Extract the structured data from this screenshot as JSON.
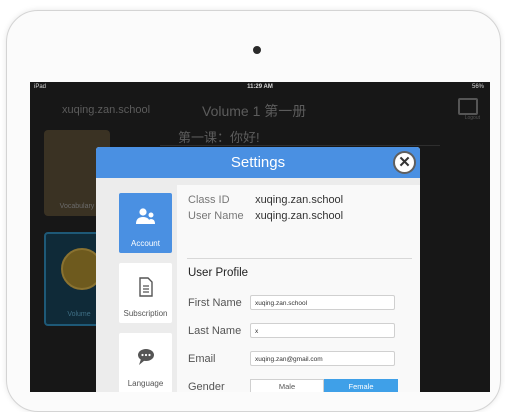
{
  "status_bar": {
    "device": "iPad",
    "time": "11:29 AM",
    "battery": "56%"
  },
  "nav": {
    "school": "xuqing.zan.school",
    "volume_title": "Volume 1 第一册",
    "logout_label": "Logout"
  },
  "sidebar": {
    "items": [
      {
        "label": "Vocabulary"
      },
      {
        "label": "Volume"
      }
    ]
  },
  "lesson_title": "第一课：你好!",
  "dialog": {
    "title": "Settings",
    "tabs": [
      {
        "label": "Account",
        "icon": "people-icon",
        "selected": true
      },
      {
        "label": "Subscription",
        "icon": "document-icon",
        "selected": false
      },
      {
        "label": "Language",
        "icon": "chat-bubble-icon",
        "selected": false
      }
    ],
    "class_id_label": "Class ID",
    "class_id_value": "xuqing.zan.school",
    "user_name_label": "User Name",
    "user_name_value": "xuqing.zan.school",
    "profile_heading": "User Profile",
    "first_name_label": "First Name",
    "first_name_value": "xuqing.zan.school",
    "last_name_label": "Last Name",
    "last_name_value": "x",
    "email_label": "Email",
    "email_value": "xuqing.zan@gmail.com",
    "gender_label": "Gender",
    "gender_options": [
      "Male",
      "Female"
    ],
    "gender_selected": "Female"
  },
  "colors": {
    "accent": "#4a90e2",
    "selected_segment": "#3fa0e8"
  }
}
